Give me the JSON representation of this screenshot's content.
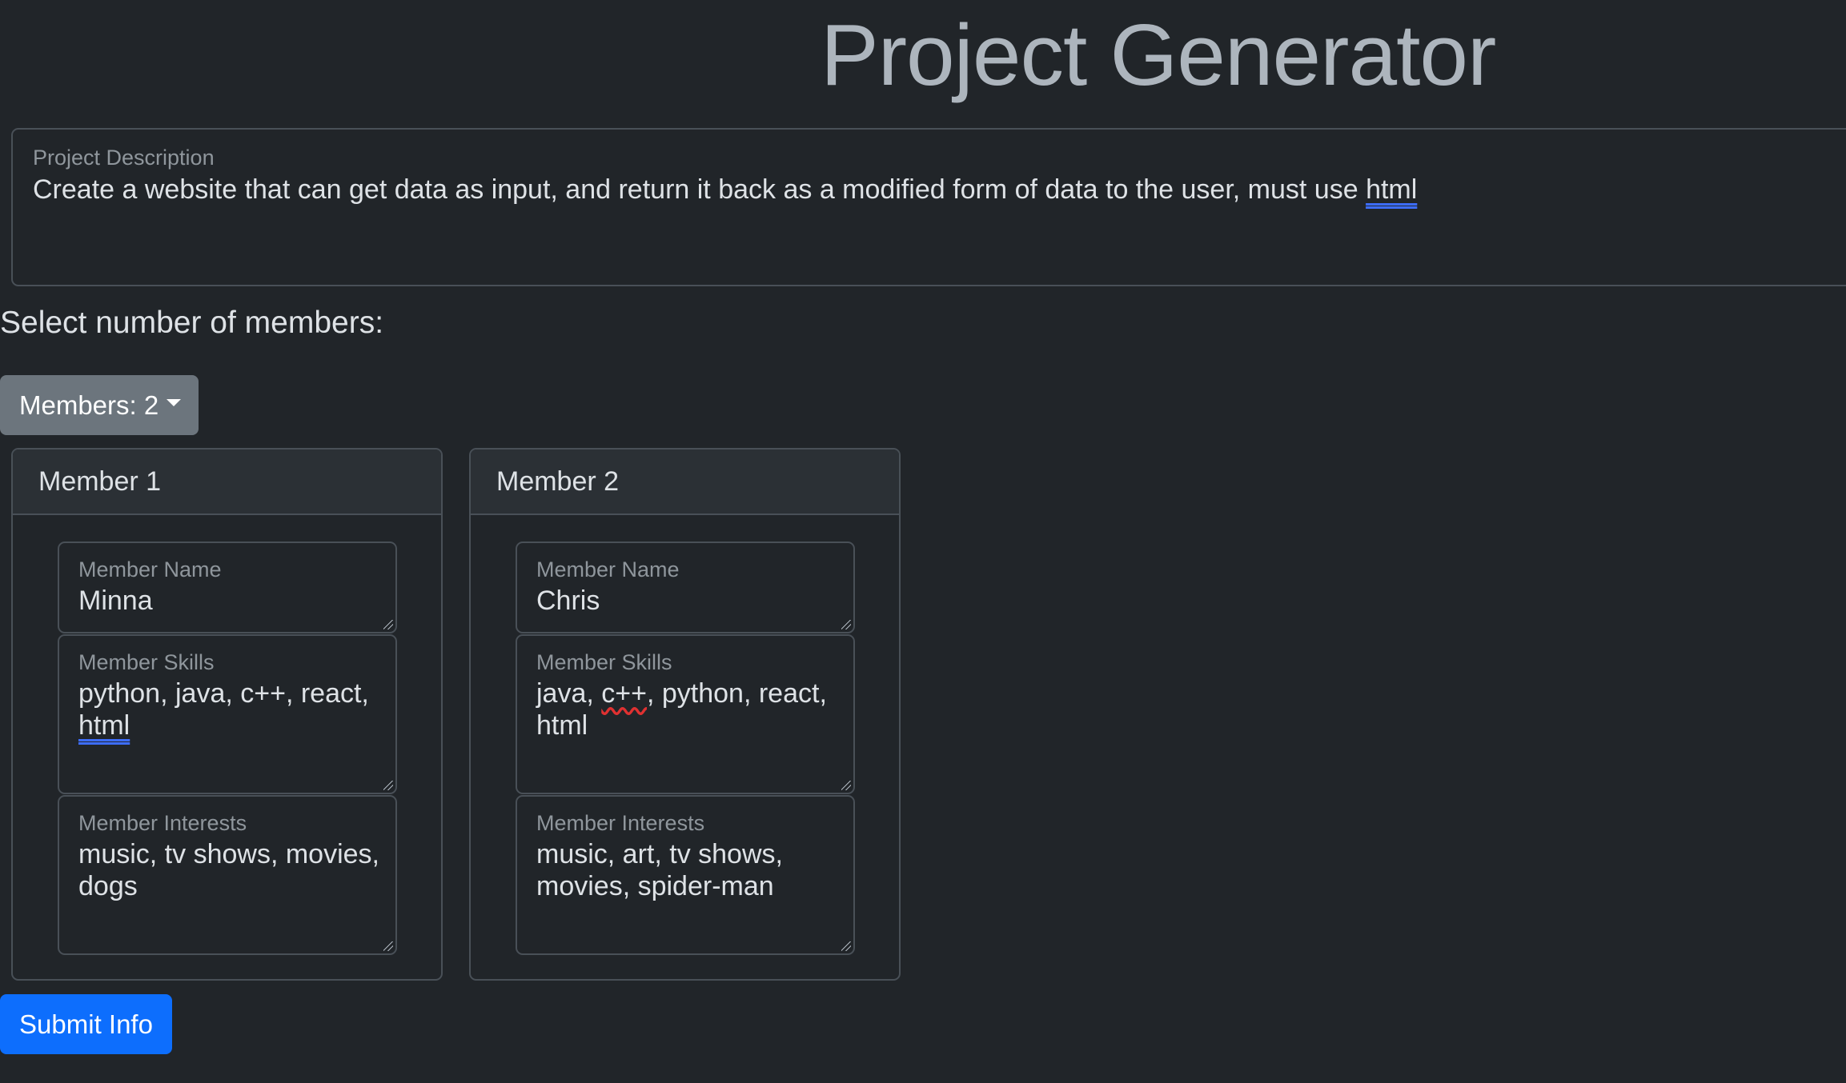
{
  "header": {
    "title": "Project Generator"
  },
  "project": {
    "label": "Project Description",
    "text_before": "Create a website that can get data as input, and return it back as a modified form of data to the user, must use ",
    "text_flagged": "html"
  },
  "members_section": {
    "prompt": "Select number of members:",
    "dropdown_label": "Members: 2"
  },
  "members": [
    {
      "title": "Member 1",
      "name_label": "Member Name",
      "name": "Minna",
      "skills_label": "Member Skills",
      "skills_main": "python, java, c++, react,",
      "skills_flagged": "html",
      "interests_label": "Member Interests",
      "interests": "music, tv shows, movies, dogs"
    },
    {
      "title": "Member 2",
      "name_label": "Member Name",
      "name": "Chris",
      "skills_label": "Member Skills",
      "skills_a": "java, ",
      "skills_flagged": "c++",
      "skills_b": ", python, react, html",
      "interests_label": "Member Interests",
      "interests": "music, art, tv shows, movies, spider-man"
    }
  ],
  "actions": {
    "submit_label": "Submit Info"
  },
  "colors": {
    "background": "#212529",
    "primary": "#0d6efd",
    "secondary": "#6c757d",
    "border": "#495057"
  }
}
